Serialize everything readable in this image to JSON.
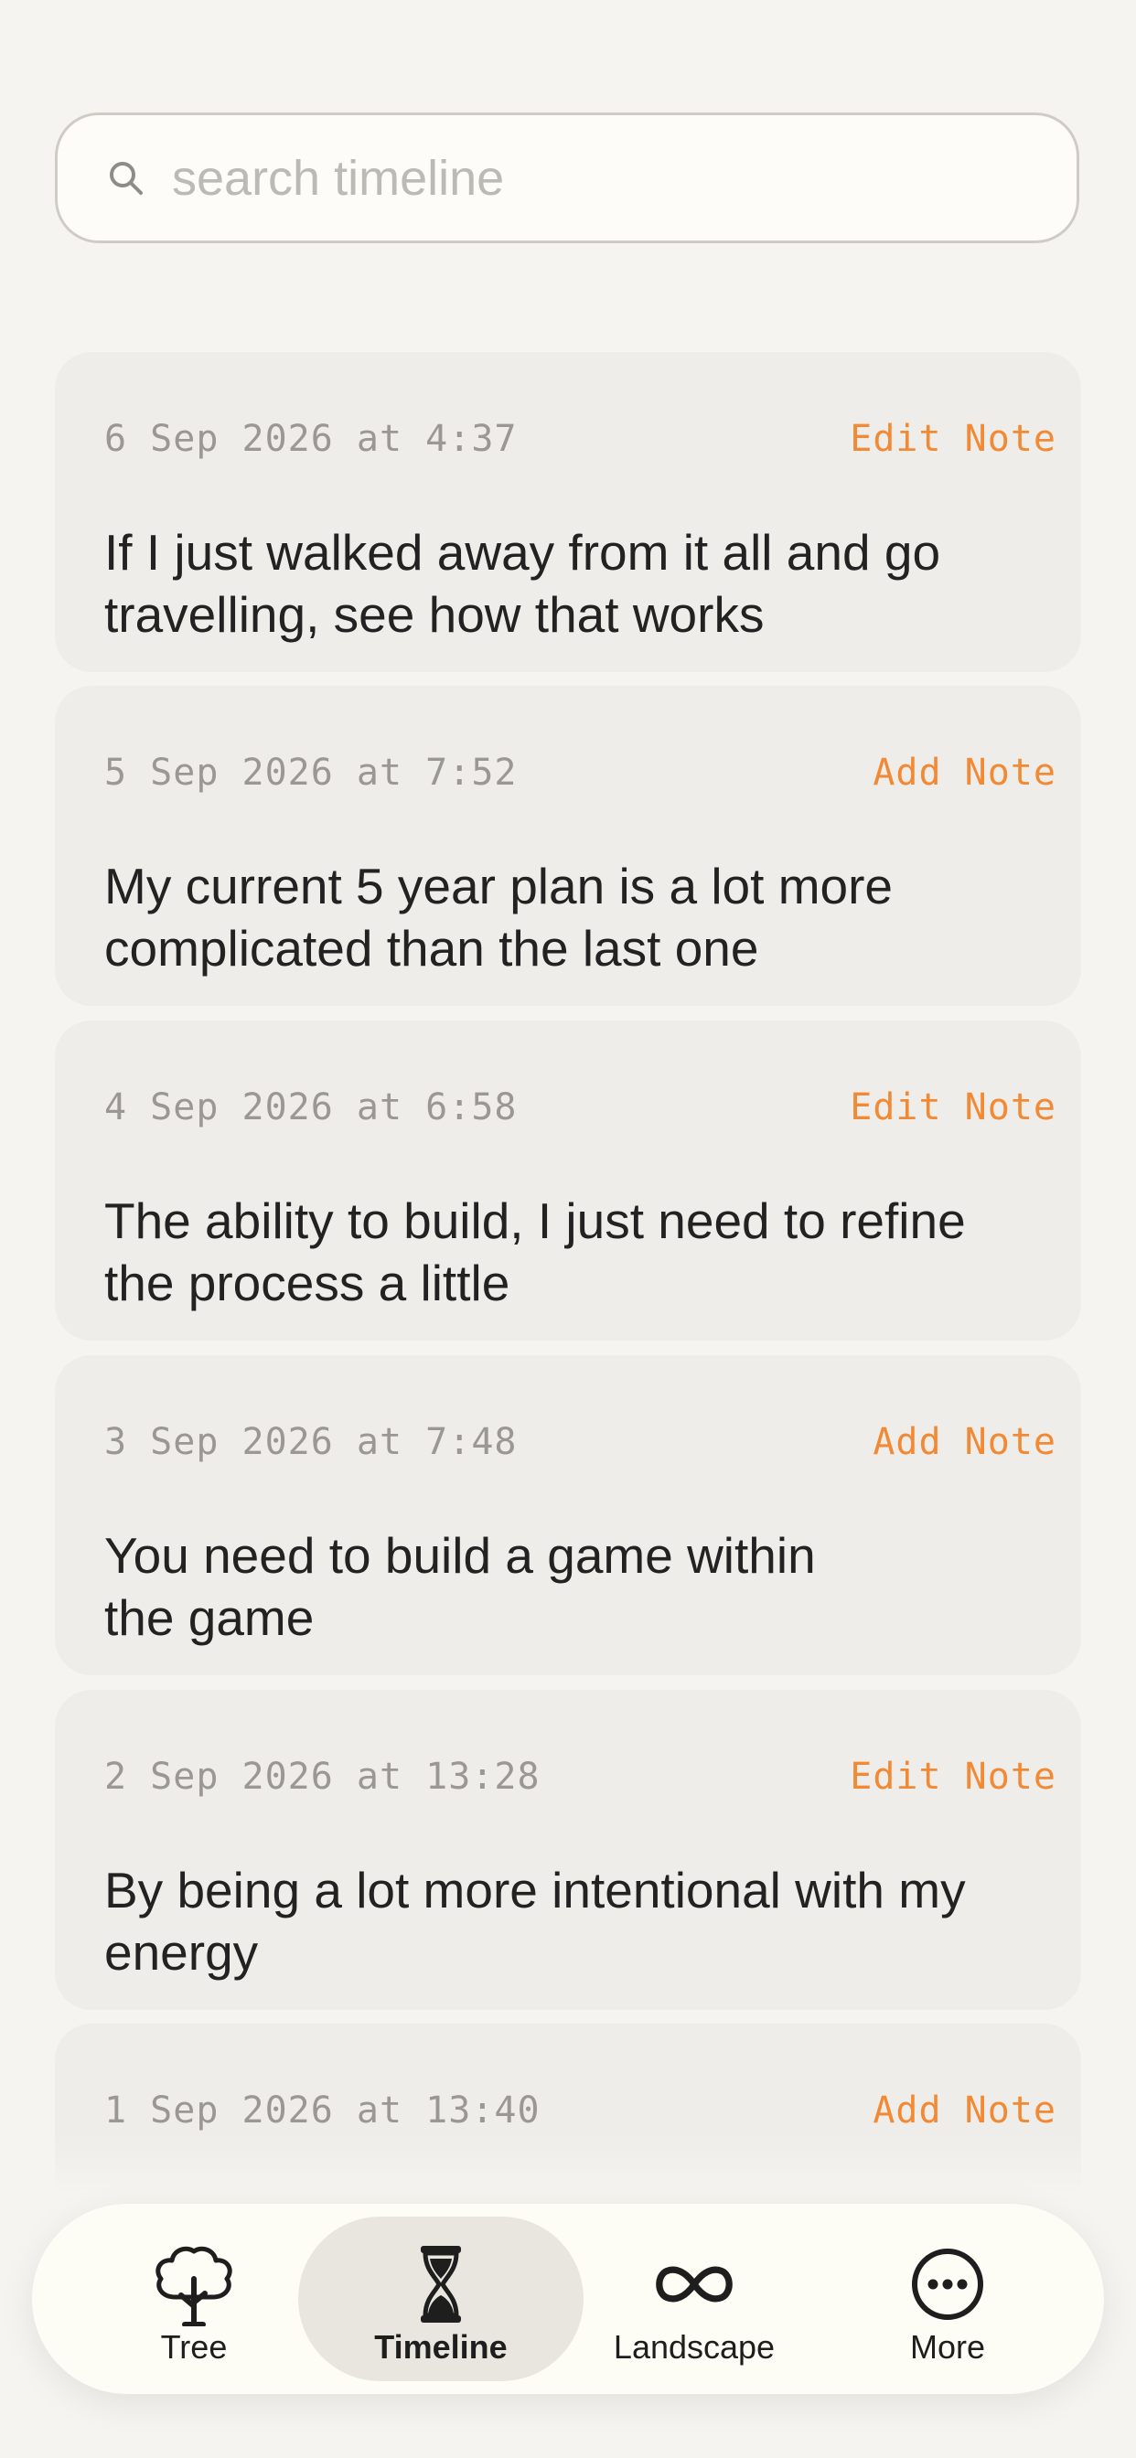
{
  "search": {
    "placeholder": "search timeline"
  },
  "entries": [
    {
      "date": "6 Sep 2026 at 4:37",
      "action": "Edit Note",
      "text": "If I just walked away from it all and go travelling, see how that works"
    },
    {
      "date": "5 Sep 2026 at 7:52",
      "action": "Add Note",
      "text": "My current 5 year plan is a lot more complicated than the last one"
    },
    {
      "date": "4 Sep 2026 at 6:58",
      "action": "Edit Note",
      "text": "The ability to build, I just need to refine the process a little"
    },
    {
      "date": "3 Sep 2026 at 7:48",
      "action": "Add Note",
      "text": "You need to build a game within the game"
    },
    {
      "date": "2 Sep 2026 at 13:28",
      "action": "Edit Note",
      "text": "By being a lot more intentional with my energy"
    },
    {
      "date": "1 Sep 2026 at 13:40",
      "action": "Add Note",
      "text": ""
    }
  ],
  "tabs": [
    {
      "label": "Tree",
      "icon": "tree-icon"
    },
    {
      "label": "Timeline",
      "icon": "hourglass-icon",
      "active": true
    },
    {
      "label": "Landscape",
      "icon": "infinity-icon"
    },
    {
      "label": "More",
      "icon": "more-icon"
    }
  ],
  "colors": {
    "accent": "#f28a35",
    "background": "#f5f4f0",
    "card": "#efede9"
  }
}
